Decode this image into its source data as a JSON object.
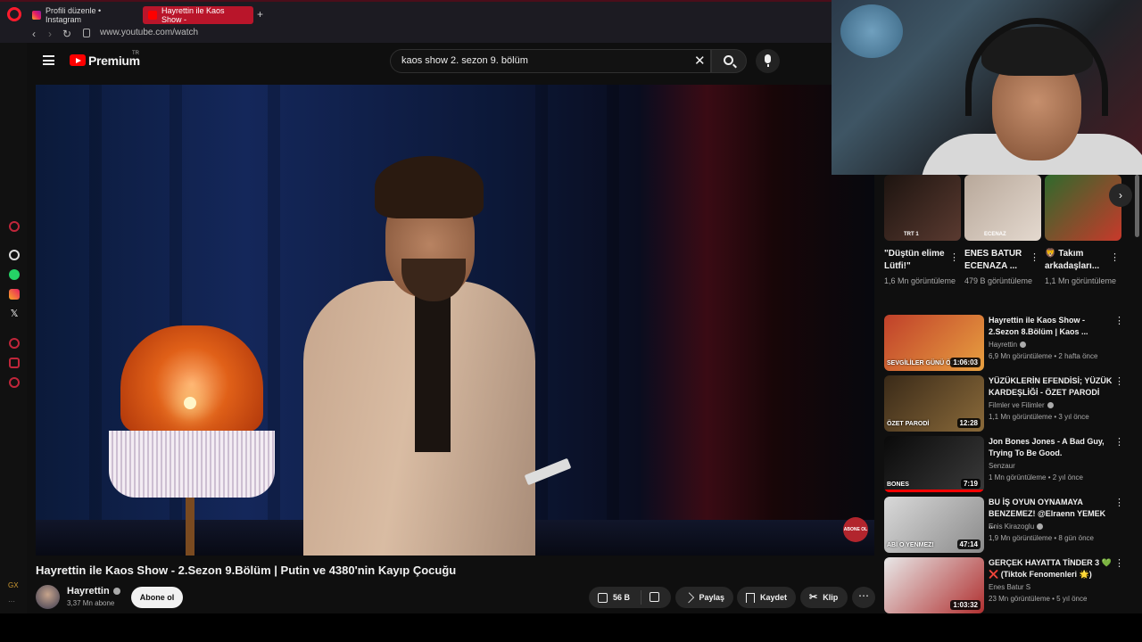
{
  "browser": {
    "tabs": [
      {
        "label": "Profili düzenle • Instagram"
      },
      {
        "label": "Hayrettin ile Kaos Show - "
      }
    ],
    "url": "www.youtube.com/watch",
    "sidebar_label": "GX"
  },
  "header": {
    "brand": "Premium",
    "brand_region": "TR",
    "search_value": "kaos show 2. sezon 9. bölüm"
  },
  "video": {
    "title": "Hayrettin ile Kaos Show - 2.Sezon 9.Bölüm | Putin ve 4380'nin Kayıp Çocuğu",
    "badge": "ABONE OL"
  },
  "channel": {
    "name": "Hayrettin",
    "subscribers": "3,37 Mn abone",
    "subscribe_label": "Abone ol"
  },
  "actions": {
    "likes": "56 B",
    "share": "Paylaş",
    "save": "Kaydet",
    "clip": "Klip"
  },
  "shorts": [
    {
      "title": "\"Düştün elime Lütfi!\"",
      "views": "1,6 Mn görüntüleme",
      "tag": "TRT 1",
      "colors": [
        "#1d1410",
        "#5a3a30"
      ]
    },
    {
      "title": "ENES BATUR ECENAZA ...",
      "views": "479 B görüntüleme",
      "tag": "ECENAZ",
      "colors": [
        "#b8a89a",
        "#e4d9cf"
      ]
    },
    {
      "title": "🦁 Takım arkadaşları...",
      "views": "1,1 Mn görüntüleme",
      "tag": "",
      "colors": [
        "#2f6a2c",
        "#c8392b"
      ]
    }
  ],
  "recommendations": [
    {
      "title": "Hayrettin ile Kaos Show - 2.Sezon 8.Bölüm | Kaos ...",
      "channel": "Hayrettin",
      "verified": true,
      "meta": "6,9 Mn görüntüleme • 2 hafta önce",
      "duration": "1:06:03",
      "overlay": "SEVGİLİLER GÜNÜ ÖZEL",
      "colors": [
        "#c0402a",
        "#e8a040"
      ]
    },
    {
      "title": "YÜZÜKLERİN EFENDİSİ; YÜZÜK KARDEŞLİĞİ - ÖZET PARODİ",
      "channel": "Filmler ve Filimler",
      "verified": true,
      "meta": "1,1 Mn görüntüleme • 3 yıl önce",
      "duration": "12:28",
      "overlay": "ÖZET PARODİ",
      "colors": [
        "#3a2a18",
        "#8a6a3a"
      ]
    },
    {
      "title": "Jon Bones Jones - A Bad Guy, Trying To Be Good.",
      "channel": "Senzaur",
      "verified": false,
      "meta": "1 Mn görüntüleme • 2 yıl önce",
      "duration": "7:19",
      "overlay": "BONES",
      "colors": [
        "#0a0a0a",
        "#3a3a3a"
      ]
    },
    {
      "title": "BU İŞ OYUN OYNAMAYA BENZEMEZ! @Elraenn YEMEK ...",
      "channel": "Enis Kirazoglu",
      "verified": true,
      "meta": "1,9 Mn görüntüleme • 8 gün önce",
      "duration": "47:14",
      "overlay": "ABİ O YENMEZ!",
      "colors": [
        "#d9d9d9",
        "#8a8a8a"
      ]
    },
    {
      "title": "GERÇEK HAYATTA TİNDER 3 💚 ❌ (Tiktok Fenomenleri 🌟)",
      "channel": "Enes Batur S",
      "verified": false,
      "meta": "23 Mn görüntüleme • 5 yıl önce",
      "duration": "1:03:32",
      "overlay": "",
      "colors": [
        "#e8e8e8",
        "#b03030"
      ]
    }
  ]
}
